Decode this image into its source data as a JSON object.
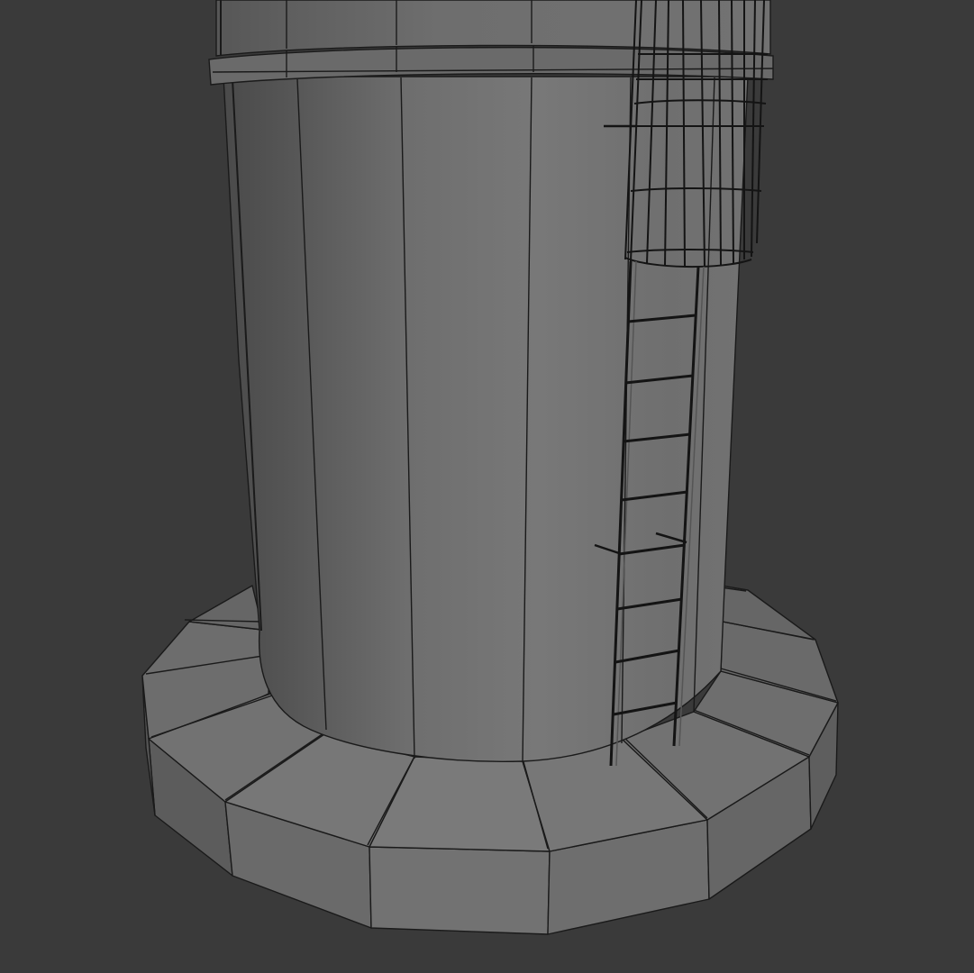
{
  "viewport": {
    "background": "#3a3a3a",
    "wire_color": "#141414",
    "shading": "edged-faces",
    "subject": "tower-base-with-ladder-and-cage"
  }
}
